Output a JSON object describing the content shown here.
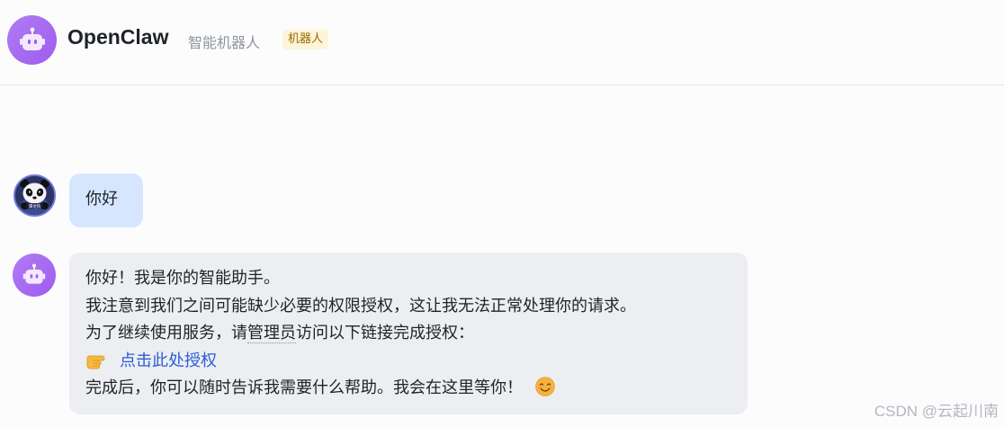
{
  "header": {
    "avatar_icon": "robot-icon",
    "title": "OpenClaw",
    "subtitle": "智能机器人",
    "tag": "机器人"
  },
  "messages": {
    "user": {
      "avatar_icon": "panda-avatar",
      "avatar_label": "谭龙钩",
      "text": "你好"
    },
    "bot": {
      "avatar_icon": "robot-icon",
      "lines": [
        "你好！我是你的智能助手。",
        "我注意到我们之间可能缺少必要的权限授权，这让我无法正常处理你的请求。"
      ],
      "line3_before": "为了继续使用服务，请",
      "line3_underlined": "管理员",
      "line3_after": "访问以下链接完成授权：",
      "pointer_icon": "pointing-hand-icon",
      "link_text": "点击此处授权",
      "closing": "完成后，你可以随时告诉我需要什么帮助。我会在这里等你！",
      "smile_icon": "smiling-face-icon"
    }
  },
  "watermark": "CSDN @云起川南",
  "colors": {
    "avatar_purple": "#a86bf1",
    "user_bubble": "#d6e6ff",
    "bot_bubble": "#eceef1",
    "link": "#2b5dd6",
    "tag_bg": "#fdf4d9",
    "tag_text": "#9b6a00"
  }
}
